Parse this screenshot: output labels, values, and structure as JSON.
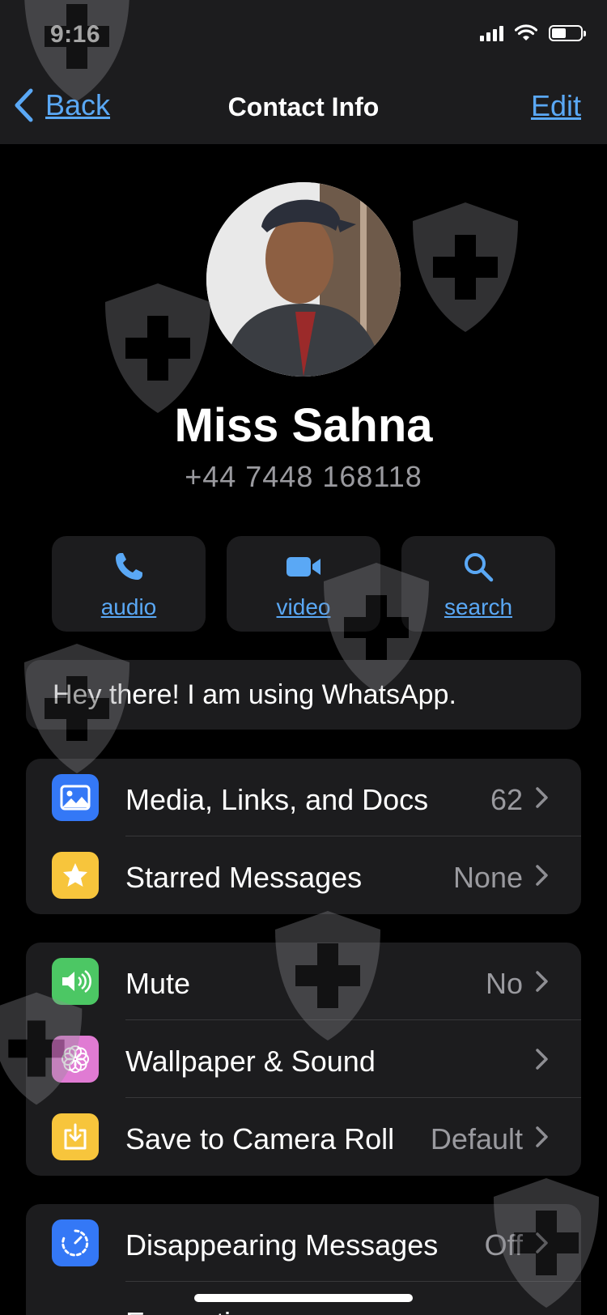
{
  "status_bar": {
    "time": "9:16"
  },
  "nav": {
    "back_label": "Back",
    "title": "Contact Info",
    "edit_label": "Edit"
  },
  "contact": {
    "name": "Miss Sahna",
    "phone": "+44 7448 168118",
    "about": "Hey there! I am using WhatsApp."
  },
  "actions": [
    {
      "label": "audio",
      "icon": "phone-icon"
    },
    {
      "label": "video",
      "icon": "video-icon"
    },
    {
      "label": "search",
      "icon": "search-icon"
    }
  ],
  "group1": [
    {
      "label": "Media, Links, and Docs",
      "value": "62",
      "icon": "photo-icon",
      "color": "#3478f6"
    },
    {
      "label": "Starred Messages",
      "value": "None",
      "icon": "star-icon",
      "color": "#f7c53c"
    }
  ],
  "group2": [
    {
      "label": "Mute",
      "value": "No",
      "icon": "speaker-icon",
      "color": "#4cc764"
    },
    {
      "label": "Wallpaper & Sound",
      "value": "",
      "icon": "flower-icon",
      "color": "#e07bd3"
    },
    {
      "label": "Save to Camera Roll",
      "value": "Default",
      "icon": "save-icon",
      "color": "#f7c53c"
    }
  ],
  "group3": [
    {
      "label": "Disappearing Messages",
      "value": "Off",
      "icon": "timer-icon",
      "color": "#3478f6"
    },
    {
      "label": "Encryption",
      "value": "",
      "icon": "lock-icon",
      "color": "#3478f6"
    }
  ],
  "colors": {
    "accent": "#5aa8f5",
    "card": "#1c1c1e",
    "secondary_text": "#9a9a9f"
  }
}
